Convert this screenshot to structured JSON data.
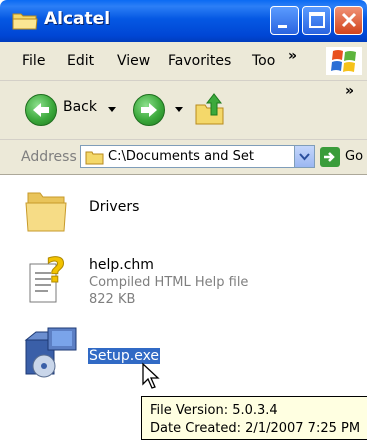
{
  "window": {
    "title": "Alcatel"
  },
  "menu": {
    "items": [
      "File",
      "Edit",
      "View",
      "Favorites",
      "Too"
    ],
    "overflow": "»"
  },
  "toolbar": {
    "back_label": "Back",
    "overflow": "»"
  },
  "address": {
    "label": "Address",
    "path": "C:\\Documents and Set",
    "go_label": "Go"
  },
  "files": [
    {
      "name": "Drivers",
      "icon": "folder-icon"
    },
    {
      "name": "help.chm",
      "type": "Compiled HTML Help file",
      "size": "822 KB",
      "icon": "help-file-icon"
    },
    {
      "name": "Setup.exe",
      "icon": "installer-icon",
      "selected": true
    }
  ],
  "tooltip": {
    "line1": "File Version: 5.0.3.4",
    "line2": "Date Created: 2/1/2007 7:25 PM"
  },
  "colors": {
    "titlebar": "#0058e6",
    "selection": "#316ac5",
    "tooltip_bg": "#ffffe1",
    "chrome": "#ece9d8"
  }
}
